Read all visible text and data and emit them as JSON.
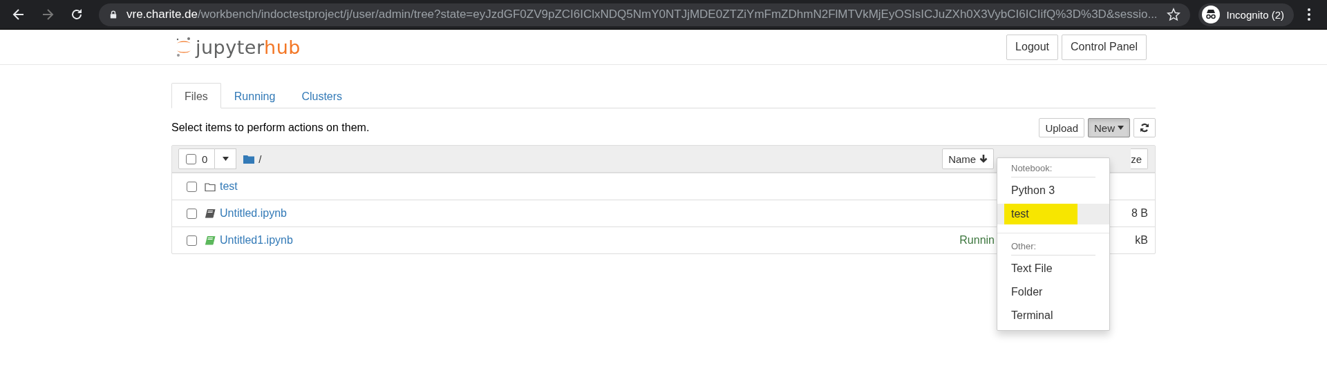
{
  "browser": {
    "url_host": "vre.charite.de",
    "url_rest": "/workbench/indoctestproject/j/user/admin/tree?state=eyJzdGF0ZV9pZCI6IClxNDQ5NmY0NTJjMDE0ZTZiYmFmZDhmN2FlMTVkMjEyOSIsICJuZXh0X3VybCI6ICIifQ%3D%3D&sessio...",
    "profile": "Incognito (2)"
  },
  "header": {
    "logo_text": "jupyter",
    "logo_accent": "hub",
    "buttons": [
      "Logout",
      "Control Panel"
    ]
  },
  "tabs": [
    {
      "label": "Files",
      "selected": true
    },
    {
      "label": "Running",
      "selected": false
    },
    {
      "label": "Clusters",
      "selected": false
    }
  ],
  "hint": "Select items to perform actions on them.",
  "toolbar": {
    "upload": "Upload",
    "new": "New"
  },
  "list_header": {
    "count": "0",
    "checked": false,
    "path": "/",
    "sort": "Name",
    "column_3": "ze"
  },
  "rows": [
    {
      "kind": "folder",
      "name": "test",
      "checked": false
    },
    {
      "kind": "notebook",
      "name": "Untitled.ipynb",
      "checked": false,
      "running": false,
      "size": "8 B"
    },
    {
      "kind": "notebook",
      "name": "Untitled1.ipynb",
      "checked": false,
      "running": true,
      "status": "Runnin",
      "size": "kB"
    }
  ],
  "menu": [
    {
      "kind": "header",
      "label": "Notebook:"
    },
    {
      "kind": "item",
      "label": "Python 3",
      "selected": false,
      "highlighted": false
    },
    {
      "kind": "item",
      "label": "test",
      "selected": true,
      "highlighted": true
    },
    {
      "kind": "divider"
    },
    {
      "kind": "header",
      "label": "Other:"
    },
    {
      "kind": "item",
      "label": "Text File",
      "selected": false,
      "highlighted": false
    },
    {
      "kind": "item",
      "label": "Folder",
      "selected": false,
      "highlighted": false
    },
    {
      "kind": "item",
      "label": "Terminal",
      "selected": false,
      "highlighted": false
    }
  ]
}
